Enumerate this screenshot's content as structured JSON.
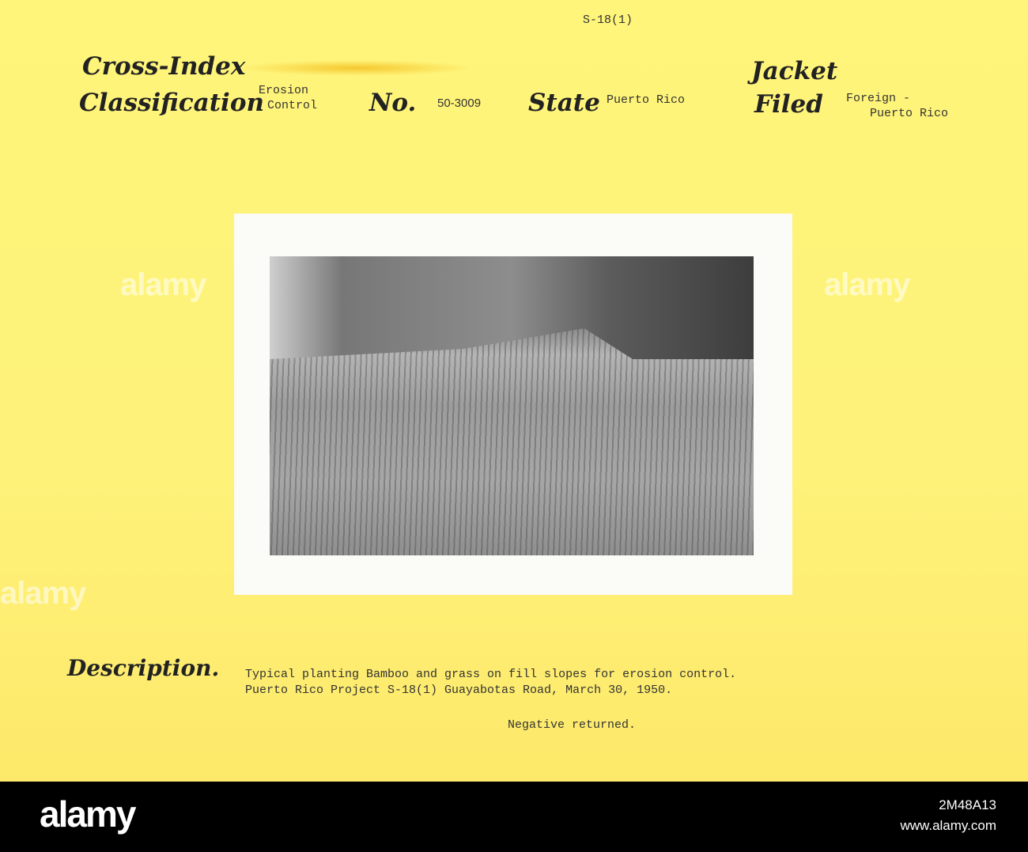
{
  "card": {
    "reference": "S-18(1)",
    "cross_index_label": "Cross-Index",
    "classification_label": "Classification",
    "classification_value": [
      "Erosion",
      "Control"
    ],
    "no_label": "No.",
    "no_value": "50-3009",
    "state_label": "State",
    "state_value": "Puerto Rico",
    "jacket_label": "Jacket",
    "filed_label": "Filed",
    "jacket_value": [
      "Foreign -",
      "Puerto Rico"
    ],
    "description_label": "Description.",
    "description_lines": [
      "Typical planting Bamboo and grass on fill slopes for erosion control.",
      "Puerto Rico Project S-18(1) Guayabotas Road, March 30, 1950."
    ],
    "note": "Negative returned."
  },
  "watermark": "alamy",
  "footer": {
    "logo": "alamy",
    "image_id": "2M48A13",
    "url": "www.alamy.com"
  }
}
